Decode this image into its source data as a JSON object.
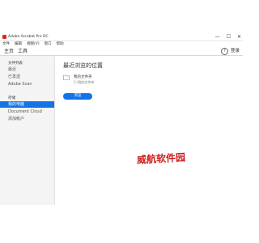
{
  "window": {
    "title": "Adobe Acrobat Pro DC",
    "controls": {
      "minimize": "—",
      "maximize": "☐",
      "close": "✕"
    }
  },
  "menu": [
    "文件",
    "编辑",
    "视图(V)",
    "窗口",
    "帮助"
  ],
  "tabs": {
    "home": "主页",
    "tools": "工具"
  },
  "header": {
    "help_icon_glyph": "?",
    "login_label": "登录"
  },
  "sidebar": {
    "recent_section": "文件列表",
    "recent_items": [
      "最近",
      "已发送",
      "Adobe Scan"
    ],
    "storage_section": "存储",
    "storage_items": [
      "我的电脑",
      "Document Cloud",
      "添加帐户"
    ]
  },
  "main": {
    "title": "最近浏览的位置",
    "file_name": "我的文件夹",
    "file_path": "C:\\我的文件夹",
    "browse_label": "浏览"
  },
  "watermark": "威航软件园",
  "colors": {
    "accent": "#1473e6",
    "sidebar_bg": "#f4f4f4",
    "watermark": "#cc1f1f",
    "app_icon": "#e2231a"
  }
}
